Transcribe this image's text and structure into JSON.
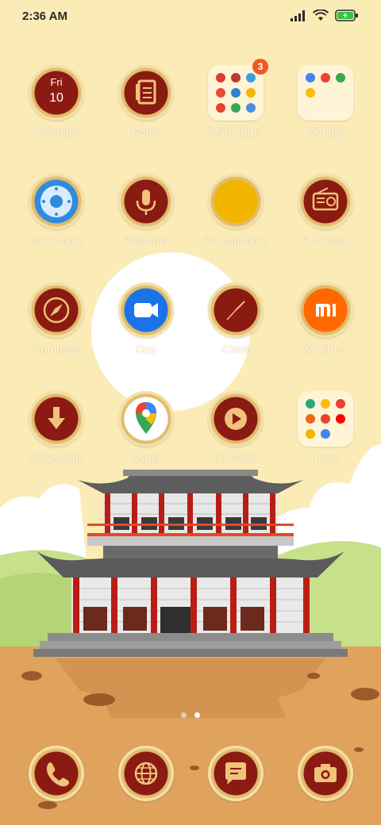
{
  "status_bar": {
    "time": "2:36 AM",
    "icons": [
      "signal-icon",
      "wifi-icon",
      "battery-charging-icon"
    ]
  },
  "apps": [
    {
      "label": "Calendar",
      "day": "Fri",
      "date": "10"
    },
    {
      "label": "Notes"
    },
    {
      "label": "More apps",
      "badge": "3"
    },
    {
      "label": "Google"
    },
    {
      "label": "Mi Remote"
    },
    {
      "label": "Recorder"
    },
    {
      "label": "File Manager"
    },
    {
      "label": "FM Radio"
    },
    {
      "label": "Compass"
    },
    {
      "label": "Duo"
    },
    {
      "label": "Clock"
    },
    {
      "label": "Mi Store"
    },
    {
      "label": "Downloads"
    },
    {
      "label": "Maps"
    },
    {
      "label": "Mi Video"
    },
    {
      "label": "Tools"
    }
  ],
  "dock": {
    "items": [
      "phone-icon",
      "browser-icon",
      "messages-icon",
      "camera-icon"
    ]
  },
  "pages": {
    "count": 2,
    "current": 2
  },
  "colors": {
    "wallpaper_sky": "#fbebb7",
    "icon_red": "#8a1a12",
    "icon_gold": "#e2bc6e",
    "ground": "#e0a35d",
    "badge": "#f05a22"
  }
}
